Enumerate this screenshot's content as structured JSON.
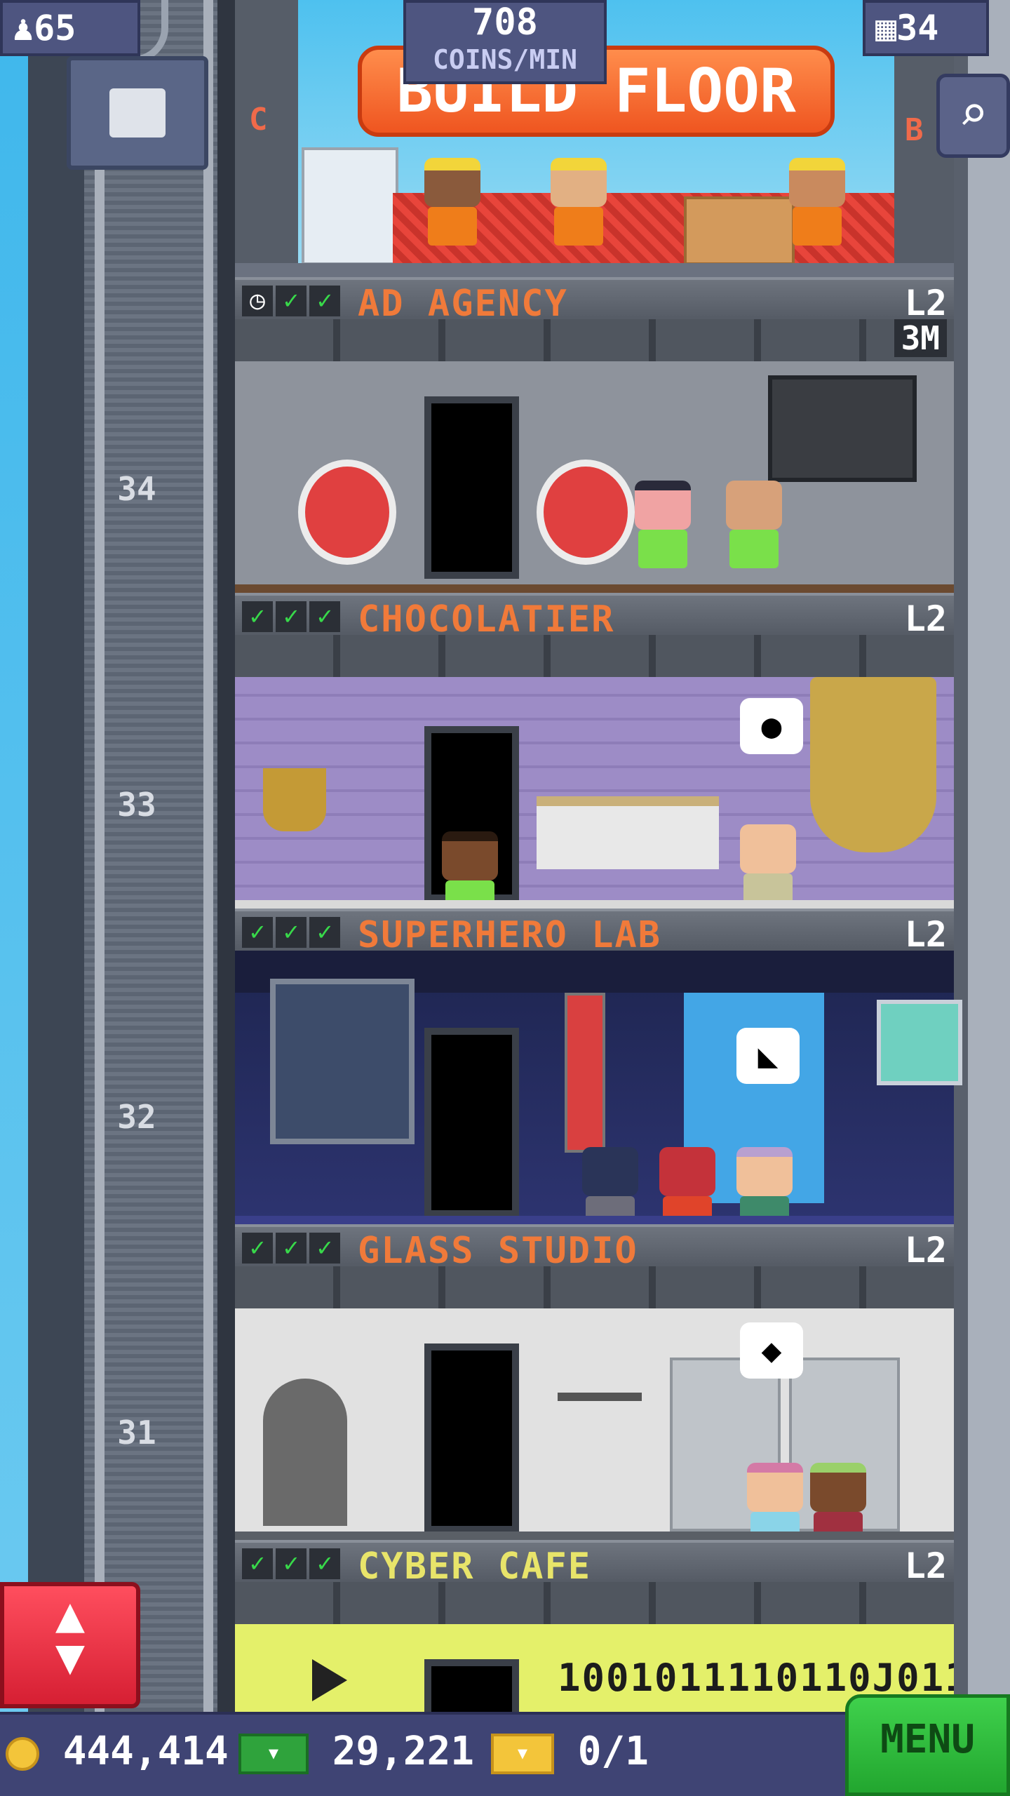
{
  "hud": {
    "population": "65",
    "floors_count": "34",
    "coins_per_min_value": "708",
    "coins_per_min_label": "COINS/MIN"
  },
  "build": {
    "label": "BUILD FLOOR",
    "side_left": "C",
    "side_right": "B"
  },
  "floors": [
    {
      "name": "AD AGENCY",
      "level": "L2",
      "number": "34",
      "timer": "3M"
    },
    {
      "name": "CHOCOLATIER",
      "level": "L2",
      "number": "33"
    },
    {
      "name": "SUPERHERO LAB",
      "level": "L2",
      "number": "32"
    },
    {
      "name": "GLASS STUDIO",
      "level": "L2",
      "number": "31"
    },
    {
      "name": "CYBER CAFE",
      "level": "L2",
      "cafe_sign": "1001011110110J011"
    }
  ],
  "bottom": {
    "coins": "444,414",
    "bux": "29,221",
    "tickets": "0/1",
    "menu_label": "MENU"
  },
  "colors": {
    "accent_orange": "#f07a3a",
    "check_green": "#38d94a",
    "menu_green": "#22a62f",
    "elevator_red": "#d61f33"
  }
}
